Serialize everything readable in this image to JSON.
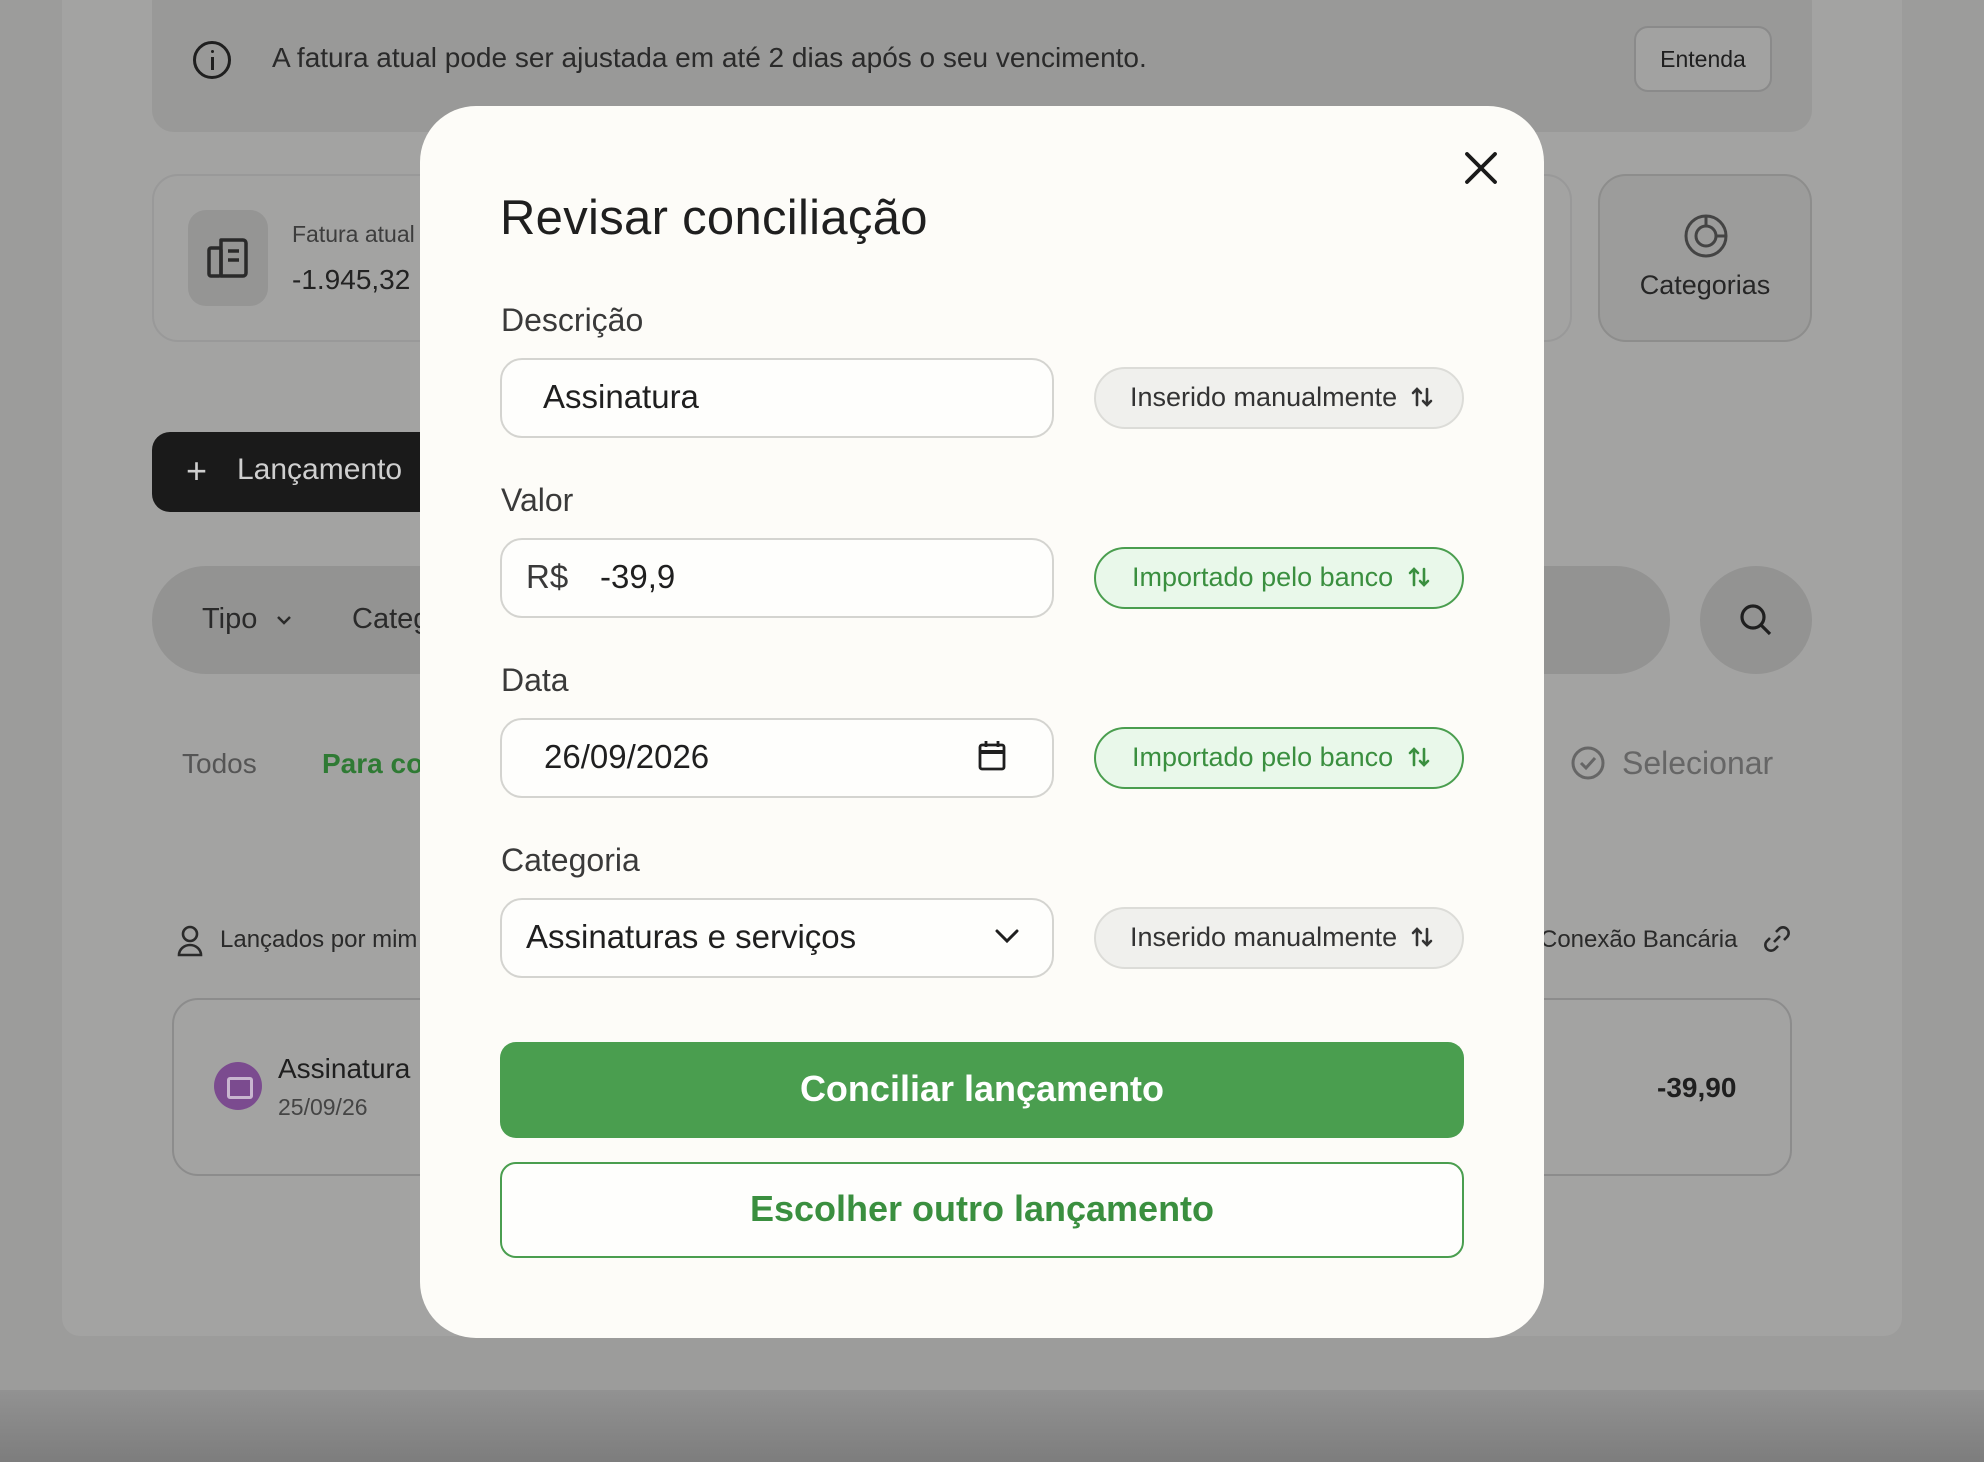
{
  "background": {
    "info_banner": {
      "text": "A fatura atual pode ser ajustada em até 2 dias após o seu vencimento.",
      "button": "Entenda",
      "icon": "info-icon"
    },
    "invoice": {
      "label": "Fatura atual",
      "value": "-1.945,32",
      "icon": "invoice-icon"
    },
    "categories_button": {
      "label": "Categorias",
      "icon": "pie-chart-icon"
    },
    "new_entry_button": {
      "label": "Lançamento",
      "icon": "plus-icon"
    },
    "filters": {
      "type_label": "Tipo",
      "category_label": "Categ",
      "search_icon": "search-icon"
    },
    "tabs": {
      "all": "Todos",
      "pending": "Para co"
    },
    "select_label": "Selecionar",
    "posted_by": "Lançados por mim",
    "bank_connection": "Conexão Bancária",
    "transaction": {
      "name": "Assinatura",
      "date": "25/09/26",
      "amount": "-39,90"
    }
  },
  "modal": {
    "title": "Revisar conciliação",
    "close_icon": "close-icon",
    "description": {
      "label": "Descrição",
      "value": "Assinatura",
      "source": "Inserido manualmente"
    },
    "amount": {
      "label": "Valor",
      "currency": "R$",
      "value": "-39,9",
      "source": "Importado pelo banco"
    },
    "date": {
      "label": "Data",
      "value": "26/09/2026",
      "source": "Importado pelo banco"
    },
    "category": {
      "label": "Categoria",
      "value": "Assinaturas e serviços",
      "source": "Inserido manualmente"
    },
    "primary_button": "Conciliar lançamento",
    "secondary_button": "Escolher outro lançamento"
  },
  "colors": {
    "accent_green": "#4a9e4f",
    "modal_background": "#fdfcf8",
    "overlay": "#9c9c9b"
  }
}
